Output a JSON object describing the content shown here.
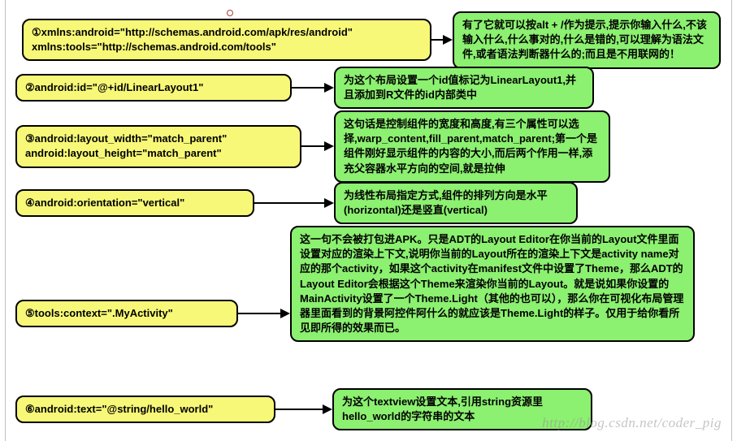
{
  "rows": [
    {
      "code": "①xmlns:android=\"http://schemas.android.com/apk/res/android\"\n    xmlns:tools=\"http://schemas.android.com/tools\"",
      "desc": "有了它就可以按alt + /作为提示,提示你输入什么,不该输入什么,什么事对的,什么是错的,可以理解为语法文件,或者语法判断器什么的;而且是不用联网的！"
    },
    {
      "code": "②android:id=\"@+id/LinearLayout1\"",
      "desc": "为这个布局设置一个id值标记为LinearLayout1,并且添加到R文件的id内部类中"
    },
    {
      "code": "③android:layout_width=\"match_parent\"\n    android:layout_height=\"match_parent\"",
      "desc": "这句话是控制组件的宽度和高度,有三个属性可以选择,warp_content,fill_parent,match_parent;第一个是组件刚好显示组件的内容的大小,而后两个作用一样,添充父容器水平方向的空间,就是拉伸"
    },
    {
      "code": "④android:orientation=\"vertical\"",
      "desc": "为线性布局指定方式,组件的排列方向是水平(horizontal)还是竖直(vertical)"
    },
    {
      "code": "⑤tools:context=\".MyActivity\"",
      "desc": "这一句不会被打包进APK。只是ADT的Layout Editor在你当前的Layout文件里面设置对应的渲染上下文,说明你当前的Layout所在的渲染上下文是activity name对应的那个activity，如果这个activity在manifest文件中设置了Theme，那么ADT的Layout Editor会根据这个Theme来渲染你当前的Layout。就是说如果你设置的MainActivity设置了一个Theme.Light（其他的也可以），那么你在可视化布局管理器里面看到的背景阿控件阿什么的就应该是Theme.Light的样子。仅用于给你看所见即所得的效果而已。"
    },
    {
      "code": "⑥android:text=\"@string/hello_world\"",
      "desc": "为这个textview设置文本,引用string资源里hello_world的字符串的文本"
    }
  ],
  "watermark": "http://blog.csdn.net/coder_pig"
}
